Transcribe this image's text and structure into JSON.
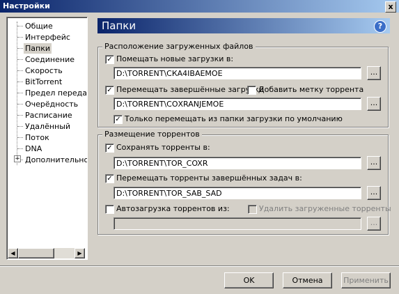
{
  "window": {
    "title": "Настройки",
    "close_glyph": "x"
  },
  "tree": {
    "items": [
      {
        "label": "Общие"
      },
      {
        "label": "Интерфейс"
      },
      {
        "label": "Папки"
      },
      {
        "label": "Соединение"
      },
      {
        "label": "Скорость"
      },
      {
        "label": "BitTorrent"
      },
      {
        "label": "Предел передачи"
      },
      {
        "label": "Очерёдность"
      },
      {
        "label": "Расписание"
      },
      {
        "label": "Удалённый"
      },
      {
        "label": "Поток"
      },
      {
        "label": "DNA"
      },
      {
        "label": "Дополнительно"
      }
    ],
    "selected": "Папки",
    "expander_glyph": "+"
  },
  "header": {
    "title": "Папки",
    "help_glyph": "?"
  },
  "downloads_group": {
    "legend": "Расположение загруженных файлов",
    "new_downloads": {
      "label": "Помещать новые загрузки в:",
      "checked": true,
      "path": "D:\\TORRENT\\СКА4IВАЕМОЕ"
    },
    "completed": {
      "label": "Перемещать завершённые загрузки",
      "checked": true,
      "path": "D:\\TORRENT\\СОХRANJЕМОЕ"
    },
    "add_label": {
      "label": "Добавить метку торрента",
      "checked": false
    },
    "only_move": {
      "label": "Только перемещать из папки загрузки по умолчанию",
      "checked": true
    }
  },
  "torrents_group": {
    "legend": "Размещение торрентов",
    "save_torrents": {
      "label": "Сохранять торренты в:",
      "checked": true,
      "path": "D:\\TORRENT\\TOR_COXR"
    },
    "move_completed": {
      "label": "Перемещать торренты завершённых задач в:",
      "checked": true,
      "path": "D:\\TORRENT\\TOR_SAB_SAD"
    },
    "autoload": {
      "label": "Автозагрузка торрентов из:",
      "checked": false,
      "path": ""
    },
    "delete_loaded": {
      "label": "Удалить загруженные торренты",
      "checked": false
    }
  },
  "browse_label": "...",
  "buttons": {
    "ok": "OK",
    "cancel": "Отмена",
    "apply": "Применить"
  }
}
